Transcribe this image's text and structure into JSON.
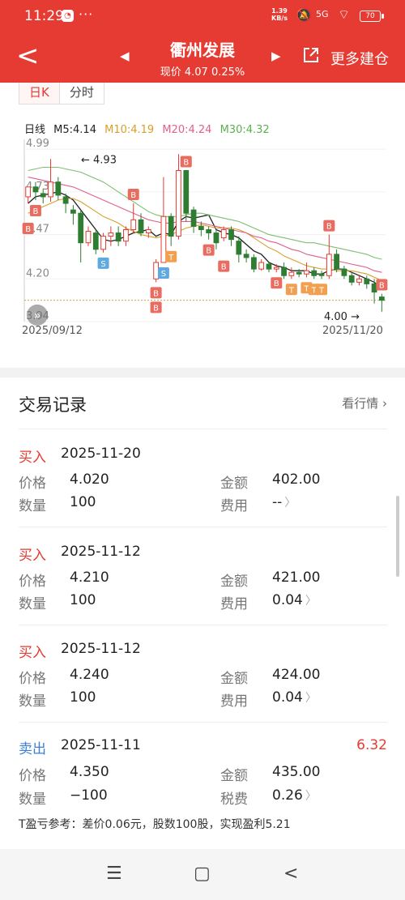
{
  "status": {
    "time": "11:29",
    "speed_top": "1.39",
    "speed_bottom": "KB/s",
    "net": "5G",
    "battery": "70",
    "app_icon": "app-icon",
    "dots": "···"
  },
  "header": {
    "title": "衢州发展",
    "subtitle": "现价 4.07 0.25%",
    "more": "更多建仓",
    "back": "<",
    "prev": "◀",
    "next": "▶"
  },
  "chart": {
    "tabs": [
      "日K",
      "分时"
    ],
    "legend": {
      "line": "日线",
      "m5": "M5:4.14",
      "m10": "M10:4.19",
      "m20": "M20:4.24",
      "m30": "M30:4.32"
    },
    "colors": {
      "up": "#e63b32",
      "down": "#2e7d32",
      "m5": "#222222",
      "m10": "#d8a02a",
      "m20": "#e0608a",
      "m30": "#7cc06f",
      "buy": "#e86c60",
      "sell": "#5fa8e0",
      "t": "#f0a050"
    },
    "y_ticks": [
      "4.99",
      "4.73",
      "4.47",
      "4.20",
      "3.94"
    ],
    "high_label": "4.93",
    "low_label": "4.00",
    "date_start": "2025/09/12",
    "date_end": "2025/11/20",
    "marker_labels": {
      "buy": "B",
      "sell": "S",
      "t": "T"
    }
  },
  "chart_data": {
    "type": "candlestick",
    "ylim": [
      3.94,
      5.05
    ],
    "candles": [
      [
        4.7,
        4.76,
        4.66,
        4.76
      ],
      [
        4.76,
        4.73,
        4.68,
        4.79
      ],
      [
        4.72,
        4.7,
        4.66,
        4.75
      ],
      [
        4.7,
        4.79,
        4.67,
        4.93
      ],
      [
        4.79,
        4.71,
        4.68,
        4.82
      ],
      [
        4.7,
        4.66,
        4.6,
        4.72
      ],
      [
        4.62,
        4.6,
        4.53,
        4.65
      ],
      [
        4.6,
        4.42,
        4.3,
        4.62
      ],
      [
        4.42,
        4.49,
        4.4,
        4.52
      ],
      [
        4.48,
        4.38,
        4.35,
        4.5
      ],
      [
        4.38,
        4.46,
        4.36,
        4.48
      ],
      [
        4.46,
        4.48,
        4.4,
        4.52
      ],
      [
        4.48,
        4.43,
        4.4,
        4.52
      ],
      [
        4.43,
        4.5,
        4.4,
        4.52
      ],
      [
        4.5,
        4.56,
        4.48,
        4.66
      ],
      [
        4.56,
        4.48,
        4.46,
        4.6
      ],
      [
        4.48,
        4.5,
        4.45,
        4.52
      ],
      [
        4.2,
        4.3,
        4.18,
        4.32
      ],
      [
        4.3,
        4.58,
        4.3,
        4.82
      ],
      [
        4.58,
        4.46,
        4.4,
        4.6
      ],
      [
        4.46,
        4.86,
        4.44,
        4.96
      ],
      [
        4.86,
        4.6,
        4.55,
        4.86
      ],
      [
        4.62,
        4.52,
        4.48,
        4.64
      ],
      [
        4.52,
        4.5,
        4.46,
        4.55
      ],
      [
        4.5,
        4.48,
        4.44,
        4.52
      ],
      [
        4.48,
        4.42,
        4.38,
        4.5
      ],
      [
        4.45,
        4.5,
        4.43,
        4.52
      ],
      [
        4.5,
        4.44,
        4.4,
        4.52
      ],
      [
        4.43,
        4.35,
        4.3,
        4.46
      ],
      [
        4.35,
        4.33,
        4.3,
        4.38
      ],
      [
        4.33,
        4.26,
        4.24,
        4.35
      ],
      [
        4.26,
        4.3,
        4.25,
        4.32
      ],
      [
        4.29,
        4.26,
        4.24,
        4.3
      ],
      [
        4.26,
        4.27,
        4.24,
        4.29
      ],
      [
        4.27,
        4.22,
        4.2,
        4.3
      ],
      [
        4.22,
        4.24,
        4.2,
        4.27
      ],
      [
        4.24,
        4.23,
        4.21,
        4.26
      ],
      [
        4.23,
        4.25,
        4.21,
        4.3
      ],
      [
        4.25,
        4.22,
        4.2,
        4.27
      ],
      [
        4.23,
        4.22,
        4.2,
        4.25
      ],
      [
        4.22,
        4.35,
        4.2,
        4.47
      ],
      [
        4.35,
        4.26,
        4.24,
        4.38
      ],
      [
        4.26,
        4.22,
        4.2,
        4.28
      ],
      [
        4.22,
        4.18,
        4.16,
        4.24
      ],
      [
        4.18,
        4.2,
        4.16,
        4.22
      ],
      [
        4.2,
        4.17,
        4.14,
        4.22
      ],
      [
        4.17,
        4.12,
        4.05,
        4.2
      ],
      [
        4.09,
        4.07,
        4.0,
        4.11
      ]
    ],
    "ma": {
      "M5": [
        4.66,
        4.7,
        4.71,
        4.72,
        4.73,
        4.71,
        4.68,
        4.62,
        4.56,
        4.5,
        4.44,
        4.43,
        4.44,
        4.46,
        4.48,
        4.49,
        4.5,
        4.46,
        4.48,
        4.47,
        4.55,
        4.58,
        4.57,
        4.58,
        4.59,
        4.5,
        4.48,
        4.47,
        4.45,
        4.41,
        4.37,
        4.35,
        4.3,
        4.28,
        4.27,
        4.25,
        4.25,
        4.25,
        4.23,
        4.23,
        4.25,
        4.26,
        4.26,
        4.24,
        4.22,
        4.2,
        4.18,
        4.14
      ],
      "M10": [
        4.6,
        4.62,
        4.64,
        4.66,
        4.68,
        4.69,
        4.69,
        4.67,
        4.64,
        4.61,
        4.58,
        4.56,
        4.54,
        4.51,
        4.49,
        4.47,
        4.46,
        4.45,
        4.46,
        4.47,
        4.49,
        4.51,
        4.52,
        4.53,
        4.52,
        4.51,
        4.51,
        4.51,
        4.5,
        4.48,
        4.45,
        4.42,
        4.39,
        4.37,
        4.34,
        4.32,
        4.3,
        4.28,
        4.27,
        4.26,
        4.26,
        4.25,
        4.25,
        4.25,
        4.24,
        4.23,
        4.21,
        4.19
      ],
      "M20": [
        4.82,
        4.81,
        4.8,
        4.79,
        4.78,
        4.77,
        4.76,
        4.74,
        4.72,
        4.7,
        4.68,
        4.66,
        4.64,
        4.62,
        4.6,
        4.58,
        4.56,
        4.55,
        4.54,
        4.54,
        4.55,
        4.55,
        4.55,
        4.54,
        4.53,
        4.52,
        4.51,
        4.5,
        4.49,
        4.48,
        4.46,
        4.45,
        4.43,
        4.42,
        4.4,
        4.38,
        4.37,
        4.35,
        4.34,
        4.33,
        4.32,
        4.31,
        4.3,
        4.29,
        4.28,
        4.27,
        4.25,
        4.24
      ],
      "M30": [
        4.86,
        4.87,
        4.88,
        4.88,
        4.88,
        4.87,
        4.86,
        4.85,
        4.83,
        4.81,
        4.79,
        4.76,
        4.73,
        4.7,
        4.67,
        4.64,
        4.61,
        4.59,
        4.58,
        4.58,
        4.58,
        4.59,
        4.6,
        4.6,
        4.59,
        4.58,
        4.57,
        4.56,
        4.55,
        4.53,
        4.51,
        4.49,
        4.47,
        4.46,
        4.45,
        4.44,
        4.43,
        4.42,
        4.42,
        4.41,
        4.4,
        4.39,
        4.38,
        4.37,
        4.36,
        4.35,
        4.33,
        4.32
      ]
    },
    "markers": [
      {
        "i": 1,
        "type": "buy",
        "pos": "below"
      },
      {
        "i": 0,
        "type": "buy",
        "pos": "below2"
      },
      {
        "i": 10,
        "type": "sell",
        "pos": "below"
      },
      {
        "i": 14,
        "type": "buy",
        "pos": "above"
      },
      {
        "i": 17,
        "type": "buy",
        "pos": "below"
      },
      {
        "i": 17,
        "type": "buy",
        "pos": "below2"
      },
      {
        "i": 18,
        "type": "sell",
        "pos": "below"
      },
      {
        "i": 19,
        "type": "t",
        "pos": "below"
      },
      {
        "i": 21,
        "type": "buy",
        "pos": "above"
      },
      {
        "i": 24,
        "type": "buy",
        "pos": "below"
      },
      {
        "i": 26,
        "type": "buy",
        "pos": "below2"
      },
      {
        "i": 33,
        "type": "buy",
        "pos": "below"
      },
      {
        "i": 35,
        "type": "t",
        "pos": "below"
      },
      {
        "i": 37,
        "type": "t",
        "pos": "below"
      },
      {
        "i": 38,
        "type": "t",
        "pos": "below"
      },
      {
        "i": 39,
        "type": "t",
        "pos": "below"
      },
      {
        "i": 40,
        "type": "buy",
        "pos": "above"
      },
      {
        "i": 47,
        "type": "buy",
        "pos": "above"
      }
    ]
  },
  "records": {
    "title": "交易记录",
    "link": "看行情 ›",
    "labels": {
      "price": "价格",
      "qty": "数量",
      "amount": "金额",
      "fee": "费用",
      "tax": "税费"
    },
    "items": [
      {
        "action": "买入",
        "date": "2025-11-20",
        "price": "4.020",
        "qty": "100",
        "amount": "402.00",
        "fee": "--",
        "pl": ""
      },
      {
        "action": "买入",
        "date": "2025-11-12",
        "price": "4.210",
        "qty": "100",
        "amount": "421.00",
        "fee": "0.04",
        "pl": ""
      },
      {
        "action": "买入",
        "date": "2025-11-12",
        "price": "4.240",
        "qty": "100",
        "amount": "424.00",
        "fee": "0.04",
        "pl": ""
      },
      {
        "action": "卖出",
        "date": "2025-11-11",
        "price": "4.350",
        "qty": "−100",
        "amount": "435.00",
        "fee": "0.26",
        "pl": "6.32"
      }
    ],
    "t_note": "T盈亏参考：差价0.06元，股数100股，实现盈利5.21"
  },
  "nav": {
    "menu": "☰",
    "home": "▢",
    "back": "<"
  }
}
